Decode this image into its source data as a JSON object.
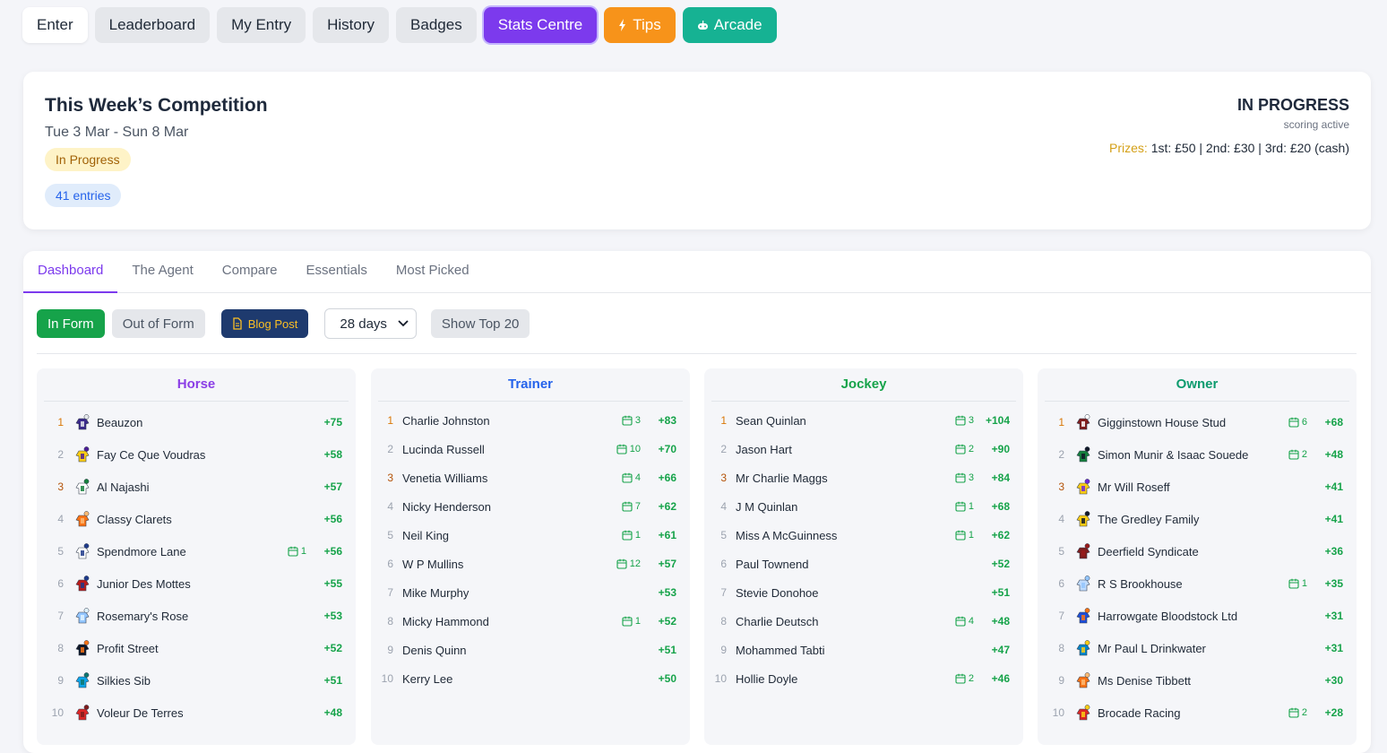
{
  "nav": [
    {
      "label": "Enter",
      "style": "white",
      "icon": ""
    },
    {
      "label": "Leaderboard",
      "style": "grey",
      "icon": ""
    },
    {
      "label": "My Entry",
      "style": "grey",
      "icon": ""
    },
    {
      "label": "History",
      "style": "grey",
      "icon": ""
    },
    {
      "label": "Badges",
      "style": "grey",
      "icon": ""
    },
    {
      "label": "Stats Centre",
      "style": "purple",
      "icon": ""
    },
    {
      "label": "Tips",
      "style": "orange",
      "icon": "lightning-icon"
    },
    {
      "label": "Arcade",
      "style": "green",
      "icon": "gamepad-icon"
    }
  ],
  "competition": {
    "title": "This Week’s Competition",
    "dates": "Tue 3 Mar - Sun 8 Mar",
    "status_pill": "In Progress",
    "entries": "41 entries",
    "status": "IN PROGRESS",
    "status_sub": "scoring active",
    "prizes_label": "Prizes:",
    "prizes_text": "1st: £50 | 2nd: £30 | 3rd: £20 (cash)"
  },
  "tabs": [
    "Dashboard",
    "The Agent",
    "Compare",
    "Essentials",
    "Most Picked"
  ],
  "filters": {
    "in_form": "In Form",
    "out_of_form": "Out of Form",
    "blog_post": "Blog Post",
    "period": "28 days",
    "show_top": "Show Top 20"
  },
  "colors": {
    "accent": "#7c3aed",
    "positive": "#16a34a",
    "tips": "#f7931a",
    "arcade": "#16b293"
  },
  "columns": [
    {
      "title": "Horse",
      "color": "purple",
      "silks": true,
      "rows": [
        {
          "rank": "1",
          "name": "Beauzon",
          "runs": "",
          "score": "+75",
          "silk": [
            "#3b2a8a",
            "#e5e7eb"
          ]
        },
        {
          "rank": "2",
          "name": "Fay Ce Que Voudras",
          "runs": "",
          "score": "+58",
          "silk": [
            "#facc15",
            "#4c1d95"
          ]
        },
        {
          "rank": "3",
          "name": "Al Najashi",
          "runs": "",
          "score": "+57",
          "silk": [
            "#ffffff",
            "#15803d"
          ]
        },
        {
          "rank": "4",
          "name": "Classy Clarets",
          "runs": "",
          "score": "+56",
          "silk": [
            "#f97316",
            "#fdba74"
          ]
        },
        {
          "rank": "5",
          "name": "Spendmore Lane",
          "runs": "1",
          "score": "+56",
          "silk": [
            "#ffffff",
            "#1e3a8a"
          ]
        },
        {
          "rank": "6",
          "name": "Junior Des Mottes",
          "runs": "",
          "score": "+55",
          "silk": [
            "#b91c1c",
            "#1e3a8a"
          ]
        },
        {
          "rank": "7",
          "name": "Rosemary's Rose",
          "runs": "",
          "score": "+53",
          "silk": [
            "#93c5fd",
            "#e0f2fe"
          ]
        },
        {
          "rank": "8",
          "name": "Profit Street",
          "runs": "",
          "score": "+52",
          "silk": [
            "#111827",
            "#f97316"
          ]
        },
        {
          "rank": "9",
          "name": "Silkies Sib",
          "runs": "",
          "score": "+51",
          "silk": [
            "#0ea5e9",
            "#0f766e"
          ]
        },
        {
          "rank": "10",
          "name": "Voleur De Terres",
          "runs": "",
          "score": "+48",
          "silk": [
            "#dc2626",
            "#7f1d1d"
          ]
        }
      ]
    },
    {
      "title": "Trainer",
      "color": "blue",
      "silks": false,
      "rows": [
        {
          "rank": "1",
          "name": "Charlie Johnston",
          "runs": "3",
          "score": "+83"
        },
        {
          "rank": "2",
          "name": "Lucinda Russell",
          "runs": "10",
          "score": "+70"
        },
        {
          "rank": "3",
          "name": "Venetia Williams",
          "runs": "4",
          "score": "+66"
        },
        {
          "rank": "4",
          "name": "Nicky Henderson",
          "runs": "7",
          "score": "+62"
        },
        {
          "rank": "5",
          "name": "Neil King",
          "runs": "1",
          "score": "+61"
        },
        {
          "rank": "6",
          "name": "W P Mullins",
          "runs": "12",
          "score": "+57"
        },
        {
          "rank": "7",
          "name": "Mike Murphy",
          "runs": "",
          "score": "+53"
        },
        {
          "rank": "8",
          "name": "Micky Hammond",
          "runs": "1",
          "score": "+52"
        },
        {
          "rank": "9",
          "name": "Denis Quinn",
          "runs": "",
          "score": "+51"
        },
        {
          "rank": "10",
          "name": "Kerry Lee",
          "runs": "",
          "score": "+50"
        }
      ]
    },
    {
      "title": "Jockey",
      "color": "green",
      "silks": false,
      "rows": [
        {
          "rank": "1",
          "name": "Sean Quinlan",
          "runs": "3",
          "score": "+104"
        },
        {
          "rank": "2",
          "name": "Jason Hart",
          "runs": "2",
          "score": "+90"
        },
        {
          "rank": "3",
          "name": "Mr Charlie Maggs",
          "runs": "3",
          "score": "+84"
        },
        {
          "rank": "4",
          "name": "J M Quinlan",
          "runs": "1",
          "score": "+68"
        },
        {
          "rank": "5",
          "name": "Miss A McGuinness",
          "runs": "1",
          "score": "+62"
        },
        {
          "rank": "6",
          "name": "Paul Townend",
          "runs": "",
          "score": "+52"
        },
        {
          "rank": "7",
          "name": "Stevie Donohoe",
          "runs": "",
          "score": "+51"
        },
        {
          "rank": "8",
          "name": "Charlie Deutsch",
          "runs": "4",
          "score": "+48"
        },
        {
          "rank": "9",
          "name": "Mohammed Tabti",
          "runs": "",
          "score": "+47"
        },
        {
          "rank": "10",
          "name": "Hollie Doyle",
          "runs": "2",
          "score": "+46"
        }
      ]
    },
    {
      "title": "Owner",
      "color": "teal",
      "silks": true,
      "rows": [
        {
          "rank": "1",
          "name": "Gigginstown House Stud",
          "runs": "6",
          "score": "+68",
          "silk": [
            "#7f1d1d",
            "#ffffff"
          ]
        },
        {
          "rank": "2",
          "name": "Simon Munir & Isaac Souede",
          "runs": "2",
          "score": "+48",
          "silk": [
            "#15803d",
            "#111827"
          ]
        },
        {
          "rank": "3",
          "name": "Mr Will Roseff",
          "runs": "",
          "score": "+41",
          "silk": [
            "#facc15",
            "#6d28d9"
          ]
        },
        {
          "rank": "4",
          "name": "The Gredley Family",
          "runs": "",
          "score": "+41",
          "silk": [
            "#facc15",
            "#111827"
          ]
        },
        {
          "rank": "5",
          "name": "Deerfield Syndicate",
          "runs": "",
          "score": "+36",
          "silk": [
            "#7f1d1d",
            "#991b1b"
          ]
        },
        {
          "rank": "6",
          "name": "R S Brookhouse",
          "runs": "1",
          "score": "+35",
          "silk": [
            "#bfdbfe",
            "#93c5fd"
          ]
        },
        {
          "rank": "7",
          "name": "Harrowgate Bloodstock Ltd",
          "runs": "",
          "score": "+31",
          "silk": [
            "#1d4ed8",
            "#f97316"
          ]
        },
        {
          "rank": "8",
          "name": "Mr Paul L Drinkwater",
          "runs": "",
          "score": "+31",
          "silk": [
            "#0284c7",
            "#facc15"
          ]
        },
        {
          "rank": "9",
          "name": "Ms Denise Tibbett",
          "runs": "",
          "score": "+30",
          "silk": [
            "#f97316",
            "#fdba74"
          ]
        },
        {
          "rank": "10",
          "name": "Brocade Racing",
          "runs": "2",
          "score": "+28",
          "silk": [
            "#dc2626",
            "#facc15"
          ]
        }
      ]
    }
  ]
}
